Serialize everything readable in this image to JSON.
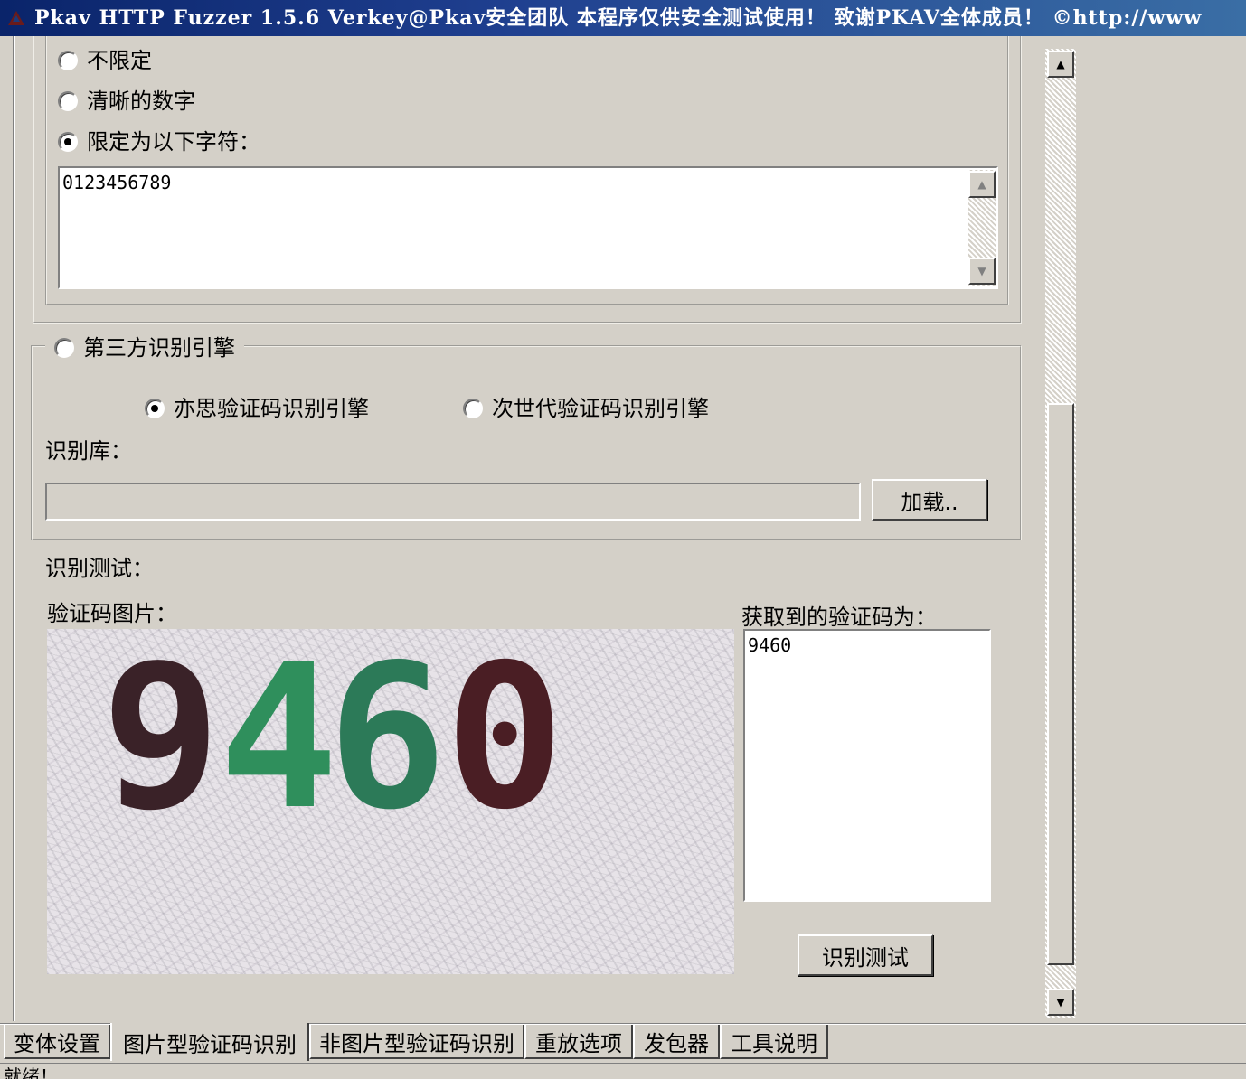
{
  "window": {
    "title": "Pkav HTTP Fuzzer 1.5.6  Verkey@Pkav安全团队  本程序仅供安全测试使用！ 致谢PKAV全体成员！ ©http://www"
  },
  "charset": {
    "options": [
      "不限定",
      "清晰的数字",
      "限定为以下字符："
    ],
    "selected_index": 2,
    "allowed_chars": "0123456789"
  },
  "third_party": {
    "legend": "第三方识别引擎",
    "engines": [
      "亦思验证码识别引擎",
      "次世代验证码识别引擎"
    ],
    "selected_engine": 0,
    "library_label": "识别库：",
    "library_path": "",
    "load_button": "加载.."
  },
  "test": {
    "heading": "识别测试：",
    "image_label": "验证码图片：",
    "captcha_digits": [
      "9",
      "4",
      "6",
      "0"
    ],
    "captcha_colors": [
      "#3a2228",
      "#2f8f5c",
      "#2c7a58",
      "#4a1e24"
    ],
    "result_label": "获取到的验证码为：",
    "result_value": "9460",
    "test_button": "识别测试"
  },
  "tabs": [
    "变体设置",
    "图片型验证码识别",
    "非图片型验证码识别",
    "重放选项",
    "发包器",
    "工具说明"
  ],
  "active_tab": 1,
  "status": "就绪！"
}
